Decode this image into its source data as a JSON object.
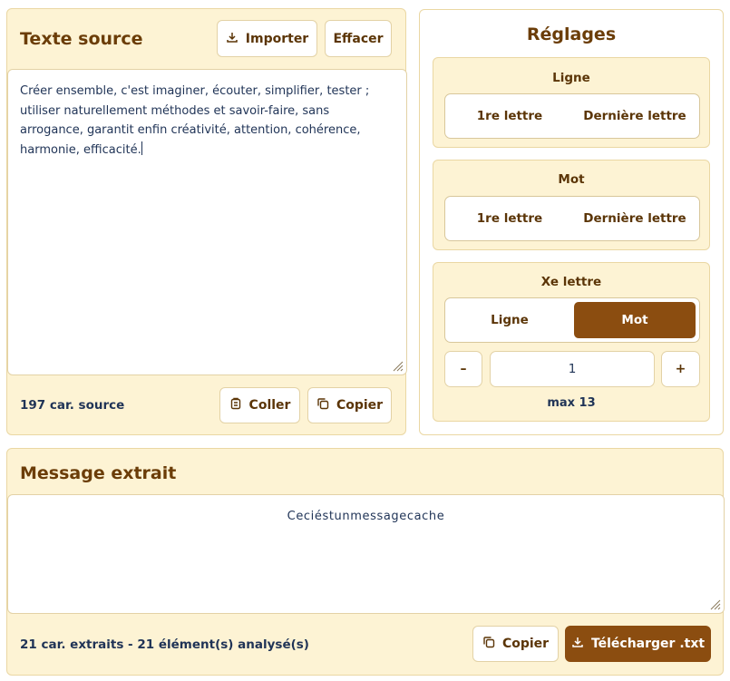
{
  "source": {
    "title": "Texte source",
    "import_label": "Importer",
    "clear_label": "Effacer",
    "text": "Créer ensemble, c'est imaginer, écouter, simplifier, tester ; utiliser naturellement méthodes et savoir-faire, sans arrogance, garantit enfin créativité, attention, cohérence, harmonie, efficacité.",
    "char_count": "197 car. source",
    "paste_label": "Coller",
    "copy_label": "Copier"
  },
  "settings": {
    "title": "Réglages",
    "groups": [
      {
        "title": "Ligne",
        "options": [
          "1re lettre",
          "Dernière lettre"
        ]
      },
      {
        "title": "Mot",
        "options": [
          "1re lettre",
          "Dernière lettre"
        ]
      }
    ],
    "nth": {
      "title": "Xe lettre",
      "options": [
        "Ligne",
        "Mot"
      ],
      "selected": "Mot",
      "minus": "–",
      "plus": "+",
      "value": "1",
      "max_label": "max 13"
    }
  },
  "output": {
    "title": "Message extrait",
    "text": "Ceciéstunmessagecache",
    "status": "21 car. extraits - 21 élément(s) analysé(s)",
    "copy_label": "Copier",
    "download_label": "Télécharger .txt"
  },
  "colors": {
    "panel_bg": "#fdf3d4",
    "accent": "#8b4d10",
    "title_brown": "#6b3d08",
    "text_navy": "#1f3356"
  }
}
